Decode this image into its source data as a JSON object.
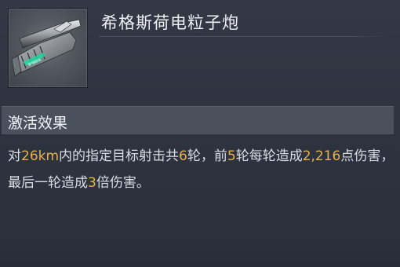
{
  "item": {
    "name": "希格斯荷电粒子炮",
    "icon": "particle-cannon-module-icon"
  },
  "section": {
    "title": "激活效果"
  },
  "effect": {
    "t1": "对",
    "range": "26km",
    "t2": "内的指定目标射击共",
    "shots": "6",
    "t3": "轮，前",
    "first_rounds": "5",
    "t4": "轮每轮造成",
    "damage": "2,216",
    "t5": "点伤害，最后一轮造成",
    "multiplier": "3",
    "t6": "倍伤害。"
  },
  "colors": {
    "highlight": "#e8b24a",
    "header_bg": "#4a505c",
    "panel_bg": "#2f3541"
  }
}
